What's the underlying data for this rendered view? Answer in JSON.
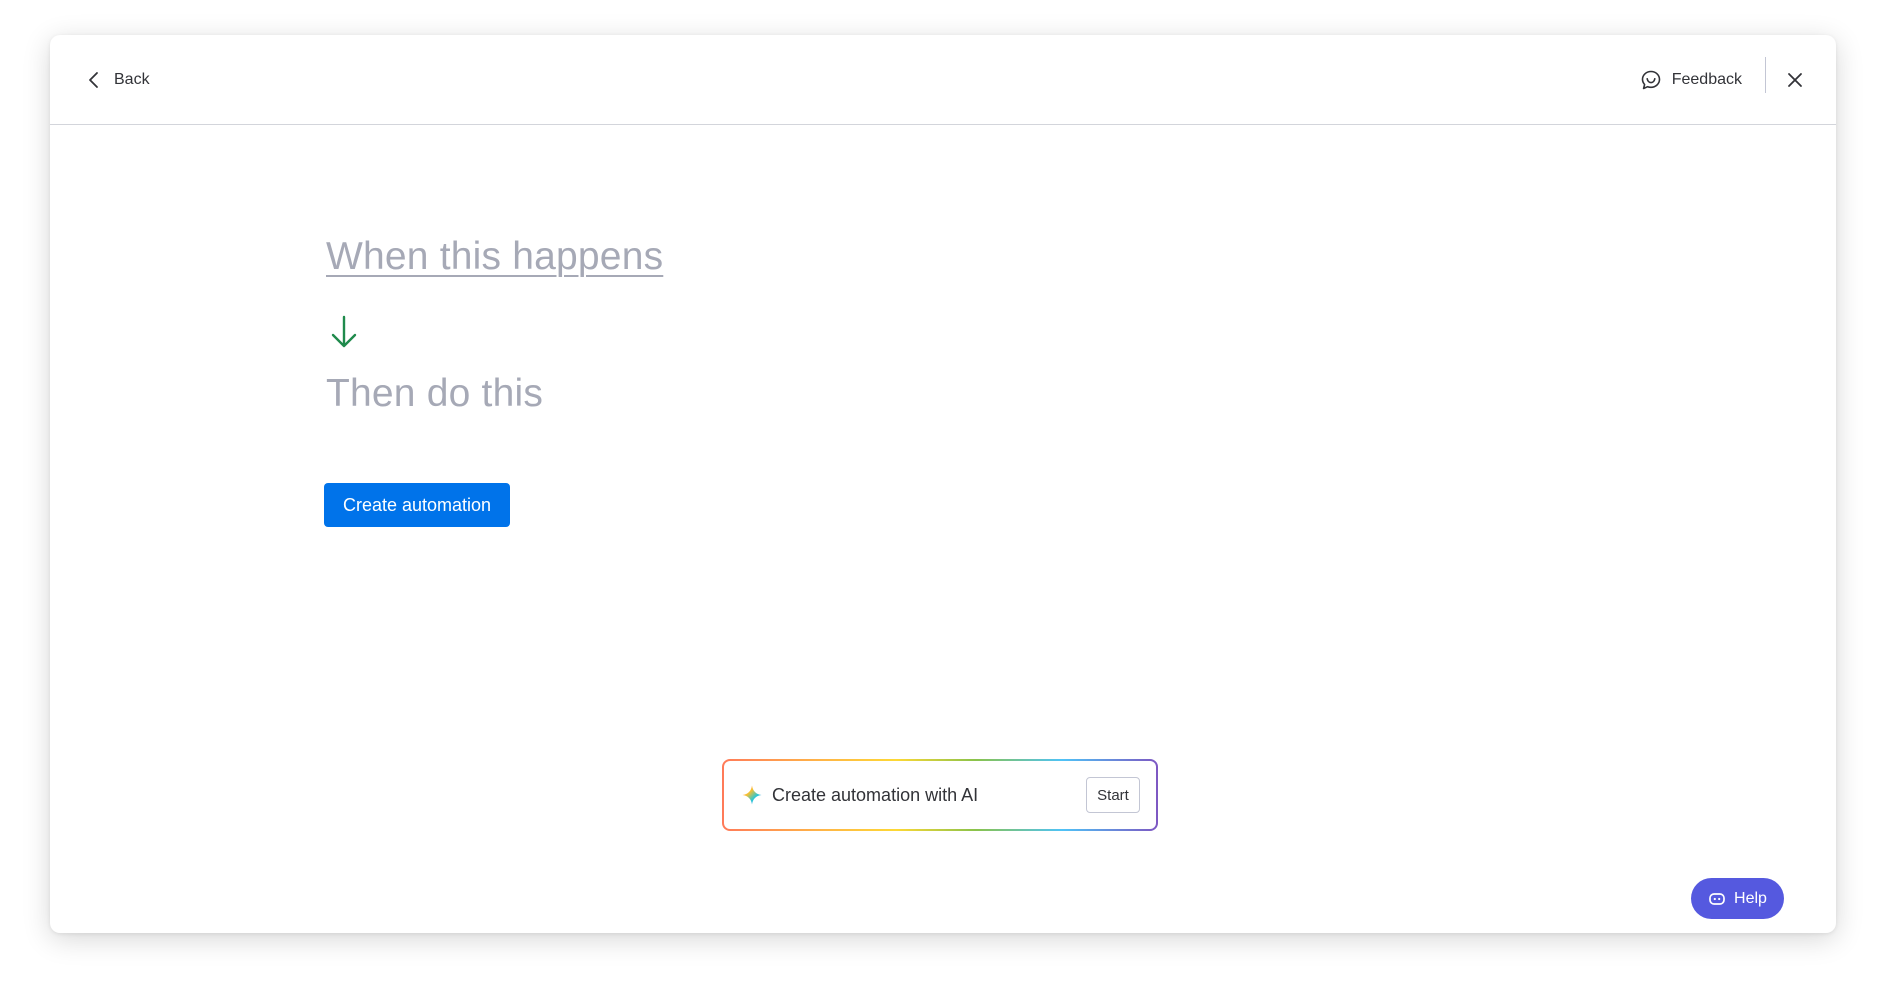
{
  "header": {
    "back_label": "Back",
    "feedback_label": "Feedback"
  },
  "builder": {
    "trigger_placeholder": "When this happens",
    "action_placeholder": "Then do this",
    "create_button_label": "Create automation"
  },
  "ai_prompt": {
    "label": "Create automation with AI",
    "start_label": "Start"
  },
  "help": {
    "label": "Help"
  },
  "icons": {
    "back": "chevron-left-icon",
    "feedback": "feedback-chat-icon",
    "close": "close-icon",
    "arrow": "arrow-down-icon",
    "sparkle": "ai-sparkle-icon",
    "help": "help-bot-icon"
  },
  "colors": {
    "primary": "#0073ea",
    "placeholder_text": "#a6a9b6",
    "arrow": "#1f8a4c",
    "help_button": "#5559df"
  }
}
